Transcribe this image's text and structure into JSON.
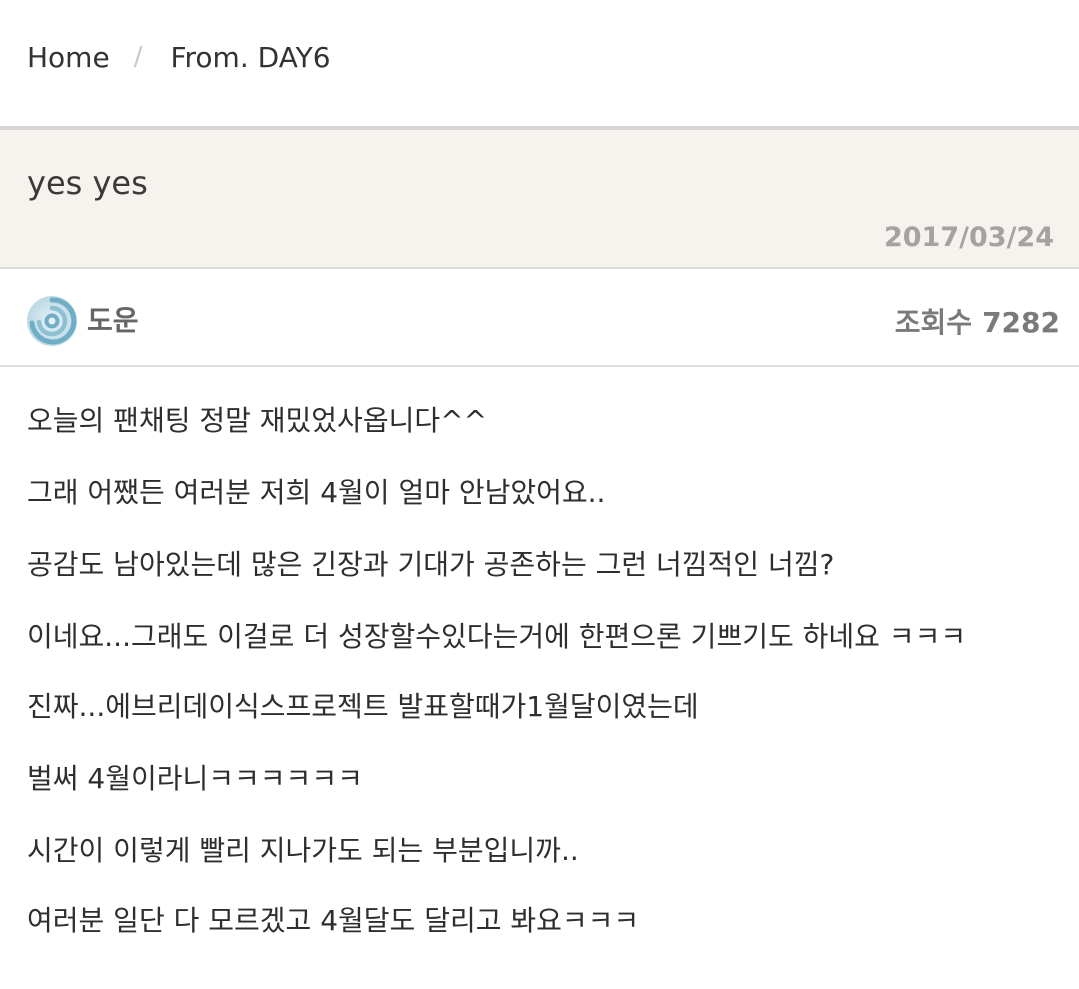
{
  "breadcrumb": {
    "home": "Home",
    "separator": "/",
    "current": "From. DAY6"
  },
  "post": {
    "title": "yes yes",
    "date": "2017/03/24"
  },
  "author": {
    "avatar_icon": "day6-logo-icon",
    "name": "도운",
    "views_label": "조회수",
    "views_count": "7282"
  },
  "body": {
    "lines": [
      "오늘의 팬채팅 정말 재밌었사옵니다^^",
      "그래 어쨌든 여러분 저희 4월이 얼마 안남았어요..",
      "공감도 남아있는데 많은 긴장과 기대가 공존하는 그런 너낌적인 너낌?",
      "이네요...그래도 이걸로 더 성장할수있다는거에 한편으론 기쁘기도 하네요 ㅋㅋㅋ",
      "진짜...에브리데이식스프로젝트 발표할때가1월달이였는데",
      "벌써 4월이라니ㅋㅋㅋㅋㅋㅋ",
      "시간이 이렇게 빨리 지나가도 되는 부분입니까..",
      "여러분 일단 다 모르겠고 4월달도 달리고 봐요ㅋㅋㅋ"
    ]
  },
  "colors": {
    "header_bg": "#f6f2ee",
    "date_color": "#a3a3a3",
    "logo_blue": "#7fb8cc"
  }
}
